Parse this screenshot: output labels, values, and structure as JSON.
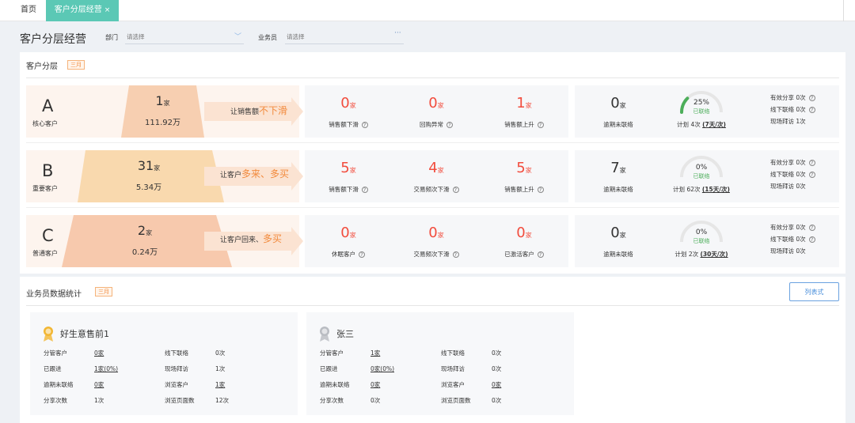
{
  "tabs": {
    "home": "首页",
    "active": "客户分层经营"
  },
  "header": {
    "title": "客户分层经营",
    "dept_label": "部门",
    "dept_placeholder": "请选择",
    "sales_label": "业务员",
    "sales_placeholder": "请选择",
    "more": "···"
  },
  "tier_section": {
    "title": "客户分层",
    "badge": "三月"
  },
  "unit": "家",
  "tiers": [
    {
      "letter": "A",
      "sub": "核心客户",
      "count": "1",
      "amount": "111.92万",
      "arrow_prefix": "让销售额",
      "arrow_emph": "不下滑",
      "stats": [
        {
          "num": "0",
          "label": "销售额下滑"
        },
        {
          "num": "0",
          "label": "回购异常"
        },
        {
          "num": "1",
          "label": "销售额上升"
        }
      ],
      "overdue": {
        "num": "0",
        "label": "逾期未联络"
      },
      "gauge": {
        "pct": "25%",
        "label": "已联络",
        "value": 0.25,
        "plan": "计划 4次 ",
        "plan_link": "(7天/次)"
      },
      "metrics": [
        "有效分享  0次",
        "线下联络  0次",
        "现场拜访  1次"
      ]
    },
    {
      "letter": "B",
      "sub": "重要客户",
      "count": "31",
      "amount": "5.34万",
      "arrow_prefix": "让客户",
      "arrow_emph": "多来、多买",
      "stats": [
        {
          "num": "5",
          "label": "销售额下滑"
        },
        {
          "num": "4",
          "label": "交易频次下滑"
        },
        {
          "num": "5",
          "label": "销售额上升"
        }
      ],
      "overdue": {
        "num": "7",
        "label": "逾期未联络"
      },
      "gauge": {
        "pct": "0%",
        "label": "已联络",
        "value": 0,
        "plan": "计划 62次 ",
        "plan_link": "(15天/次)"
      },
      "metrics": [
        "有效分享  0次",
        "线下联络  0次",
        "现场拜访  0次"
      ]
    },
    {
      "letter": "C",
      "sub": "普通客户",
      "count": "2",
      "amount": "0.24万",
      "arrow_prefix": "让客户回来、",
      "arrow_emph": "多买",
      "stats": [
        {
          "num": "0",
          "label": "休眠客户"
        },
        {
          "num": "0",
          "label": "交易频次下滑"
        },
        {
          "num": "0",
          "label": "已激活客户"
        }
      ],
      "overdue": {
        "num": "0",
        "label": "逾期未联络"
      },
      "gauge": {
        "pct": "0%",
        "label": "已联络",
        "value": 0,
        "plan": "计划 2次 ",
        "plan_link": "(30天/次)"
      },
      "metrics": [
        "有效分享  0次",
        "线下联络  0次",
        "现场拜访  0次"
      ]
    }
  ],
  "sales_section": {
    "title": "业务员数据统计",
    "badge": "三月",
    "list_button": "列表式"
  },
  "salespeople": [
    {
      "name": "好生意售前1",
      "medal": "gold",
      "left": [
        {
          "label": "分管客户",
          "value": "0家",
          "link": true
        },
        {
          "label": "已跟进",
          "value": "1家(0%)",
          "link": true
        },
        {
          "label": "逾期未联络",
          "value": "0家",
          "link": true
        },
        {
          "label": "分享次数",
          "value": "1次",
          "link": false
        }
      ],
      "right": [
        {
          "label": "线下联络",
          "value": "0次",
          "link": false
        },
        {
          "label": "现场拜访",
          "value": "1次",
          "link": false
        },
        {
          "label": "浏览客户",
          "value": "1家",
          "link": true
        },
        {
          "label": "浏览页面数",
          "value": "12次",
          "link": false
        }
      ]
    },
    {
      "name": "张三",
      "medal": "silver",
      "left": [
        {
          "label": "分管客户",
          "value": "1家",
          "link": true
        },
        {
          "label": "已跟进",
          "value": "0家(0%)",
          "link": true
        },
        {
          "label": "逾期未联络",
          "value": "0家",
          "link": true
        },
        {
          "label": "分享次数",
          "value": "0次",
          "link": false
        }
      ],
      "right": [
        {
          "label": "线下联络",
          "value": "0次",
          "link": false
        },
        {
          "label": "现场拜访",
          "value": "0次",
          "link": false
        },
        {
          "label": "浏览客户",
          "value": "0家",
          "link": true
        },
        {
          "label": "浏览页面数",
          "value": "0次",
          "link": false
        }
      ]
    }
  ],
  "colors": {
    "accent": "#5bc8b5",
    "orange": "#f28a3c",
    "red": "#f24c3d",
    "green": "#4cae5a",
    "gauge_track": "#e6e6e6",
    "medal_gold": "#f2b632",
    "medal_silver": "#b9bcc2"
  }
}
